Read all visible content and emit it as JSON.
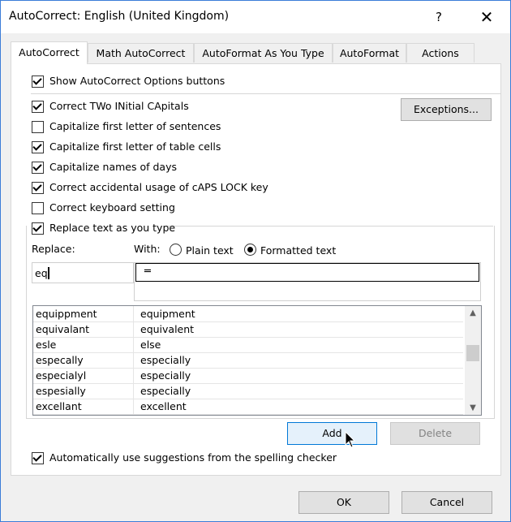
{
  "window": {
    "title": "AutoCorrect: English (United Kingdom)",
    "help_glyph": "?",
    "close_glyph": "✕"
  },
  "tabs": [
    {
      "label": "AutoCorrect",
      "active": true
    },
    {
      "label": "Math AutoCorrect",
      "active": false
    },
    {
      "label": "AutoFormat As You Type",
      "active": false
    },
    {
      "label": "AutoFormat",
      "active": false
    },
    {
      "label": "Actions",
      "active": false
    }
  ],
  "options": {
    "show_buttons": {
      "label": "Show AutoCorrect Options buttons",
      "checked": true
    },
    "two_initials": {
      "label": "Correct TWo INitial CApitals",
      "checked": true
    },
    "first_letter_sentences": {
      "label": "Capitalize first letter of sentences",
      "checked": false
    },
    "first_letter_cells": {
      "label": "Capitalize first letter of table cells",
      "checked": true
    },
    "names_of_days": {
      "label": "Capitalize names of days",
      "checked": true
    },
    "caps_lock": {
      "label": "Correct accidental usage of cAPS LOCK key",
      "checked": true
    },
    "keyboard_setting": {
      "label": "Correct keyboard setting",
      "checked": false
    },
    "replace_text": {
      "label": "Replace text as you type",
      "checked": true
    },
    "spelling_suggestions": {
      "label": "Automatically use suggestions from the spelling checker",
      "checked": true
    }
  },
  "exceptions_label": "Exceptions...",
  "replace": {
    "replace_label": "Replace:",
    "with_label": "With:",
    "plain_text_label": "Plain text",
    "formatted_text_label": "Formatted text",
    "formatted_selected": true,
    "replace_value": "eq",
    "with_value": "═"
  },
  "entries": [
    {
      "from": "equippment",
      "to": "equipment"
    },
    {
      "from": "equivalant",
      "to": "equivalent"
    },
    {
      "from": "esle",
      "to": "else"
    },
    {
      "from": "especally",
      "to": "especially"
    },
    {
      "from": "especialyl",
      "to": "especially"
    },
    {
      "from": "espesially",
      "to": "especially"
    },
    {
      "from": "excellant",
      "to": "excellent"
    }
  ],
  "buttons": {
    "add": "Add",
    "delete": "Delete",
    "ok": "OK",
    "cancel": "Cancel"
  },
  "scroll": {
    "up": "▲",
    "down": "▼"
  }
}
